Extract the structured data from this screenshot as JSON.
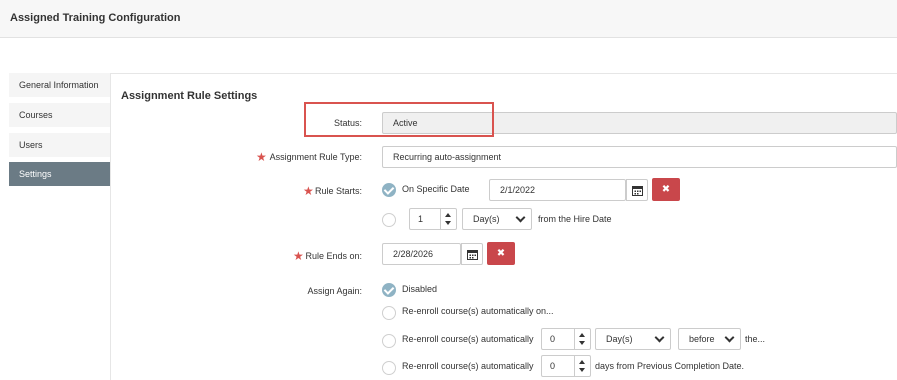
{
  "header": {
    "title": "Assigned Training Configuration"
  },
  "sidebar": {
    "items": [
      {
        "label": "General Information"
      },
      {
        "label": "Courses"
      },
      {
        "label": "Users"
      },
      {
        "label": "Settings",
        "active": true
      }
    ]
  },
  "section": {
    "title": "Assignment Rule Settings"
  },
  "status": {
    "label": "Status:",
    "value": "Active"
  },
  "rule_type": {
    "label": "Assignment Rule Type:",
    "value": "Recurring auto-assignment"
  },
  "rule_starts": {
    "label": "Rule Starts:",
    "option_specific": "On Specific Date",
    "date": "2/1/2022",
    "offset_value": "1",
    "offset_unit": "Day(s)",
    "offset_suffix": "from the Hire Date"
  },
  "rule_ends": {
    "label": "Rule Ends on:",
    "date": "2/28/2026"
  },
  "assign_again": {
    "label": "Assign Again:",
    "options": [
      {
        "label": "Disabled",
        "checked": true
      },
      {
        "label": "Re-enroll course(s) automatically on..."
      },
      {
        "label": "Re-enroll course(s) automatically",
        "value": "0",
        "unit": "Day(s)",
        "when": "before",
        "suffix": "the..."
      },
      {
        "label": "Re-enroll course(s) automatically",
        "value": "0",
        "suffix": "days from Previous Completion Date."
      }
    ]
  },
  "delete_symbol": "✖",
  "required_mark": "★",
  "colors": {
    "accent": "#8fb3c4",
    "danger": "#c9474b",
    "sidebar_active": "#6b7b85"
  }
}
